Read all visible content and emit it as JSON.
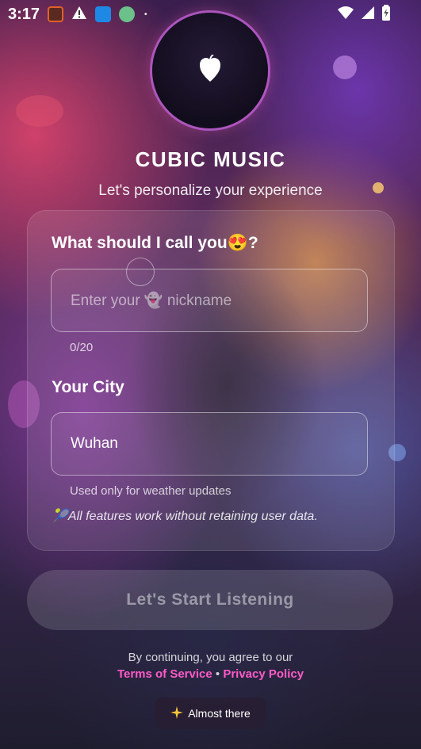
{
  "status_bar": {
    "time": "3:17",
    "app_icons": [
      "clock-app-icon",
      "warning-icon",
      "layers-app-icon",
      "bird-app-icon"
    ],
    "dot": "•",
    "system_icons": [
      "wifi-icon",
      "signal-icon",
      "battery-icon"
    ]
  },
  "header": {
    "app_name": "CUBIC MUSIC",
    "subtitle": "Let's personalize your experience"
  },
  "form": {
    "name_label": "What should I call you😍?",
    "name_placeholder": "Enter your 👻 nickname",
    "name_counter": "0/20",
    "city_label": "Your City",
    "city_value": "Wuhan",
    "city_hint": "Used only for weather updates",
    "privacy_note": "🎾All features work without retaining user data."
  },
  "cta": {
    "label": "Let's Start Listening"
  },
  "legal": {
    "intro": "By continuing, you agree to our",
    "terms": "Terms of Service",
    "separator": "•",
    "privacy": "Privacy Policy"
  },
  "badge": {
    "icon": "sparkle-icon",
    "label": "Almost there"
  },
  "colors": {
    "link": "#ff5bc8",
    "logo_ring": "#b45ac8"
  }
}
